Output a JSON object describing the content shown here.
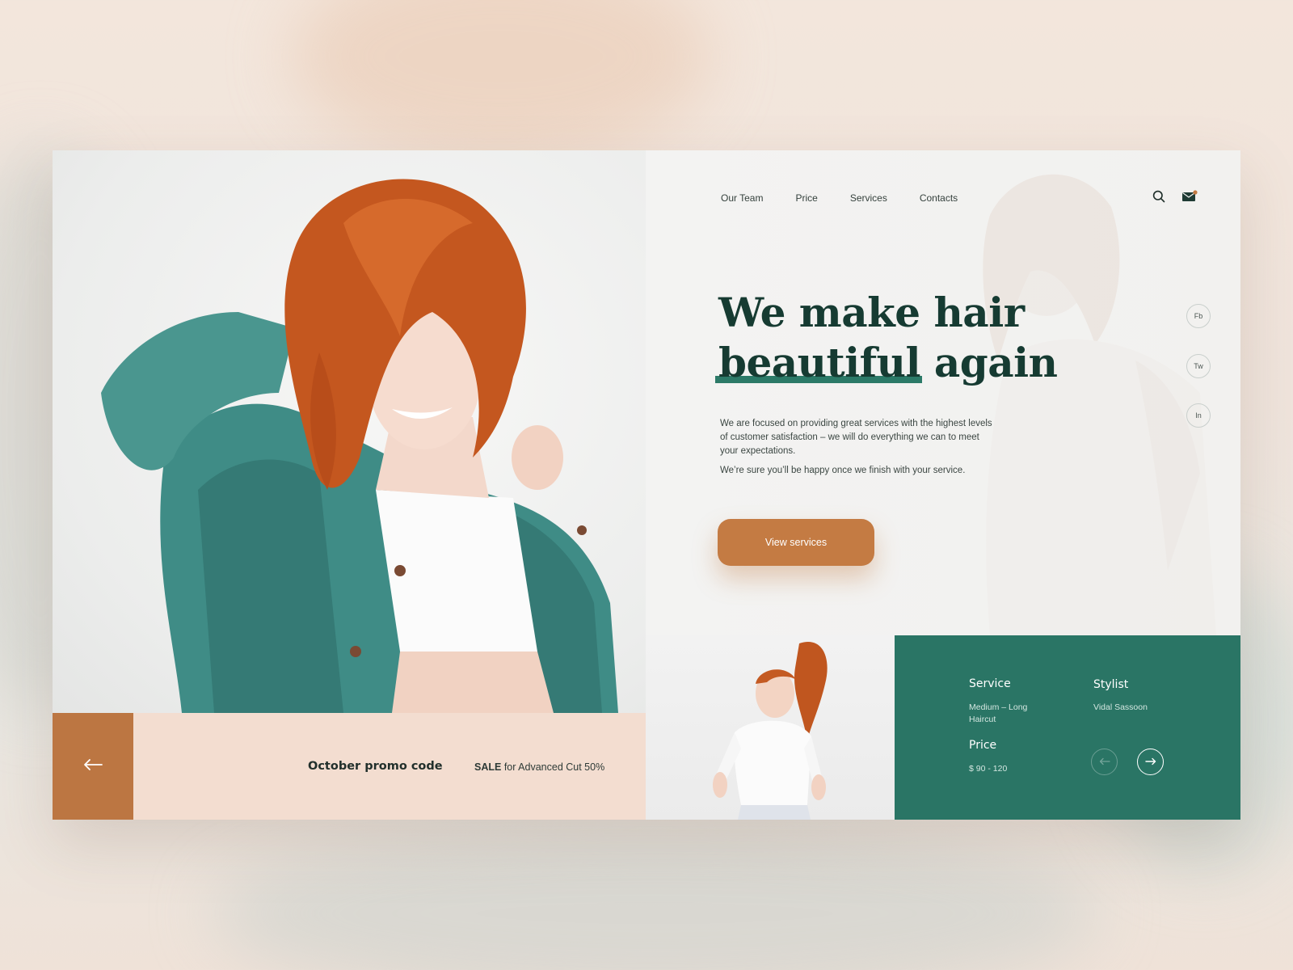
{
  "nav": {
    "items": [
      "Our Team",
      "Price",
      "Services",
      "Contacts"
    ]
  },
  "icons": {
    "search": "search-icon",
    "mail": "mail-icon",
    "arrow_left": "arrow-left-icon",
    "arrow_right": "arrow-right-icon"
  },
  "hero": {
    "headline_line1": "We make hair",
    "headline_word_underlined": "beautiful",
    "headline_line2_rest": " again",
    "paragraph1": "We are focused on providing great services with the highest levels of customer satisfaction – we will do everything we can to meet your expectations.",
    "paragraph2": "We’re sure you’ll be happy once we finish with your service.",
    "cta_label": "View services"
  },
  "social": {
    "fb": "Fb",
    "tw": "Tw",
    "in": "In"
  },
  "promo": {
    "title": "October promo code",
    "sale_strong": "SALE",
    "sale_rest": " for Advanced Cut 50%"
  },
  "service_card": {
    "service_label": "Service",
    "service_value": "Medium – Long Haircut",
    "stylist_label": "Stylist",
    "stylist_value": "Vidal Sassoon",
    "price_label": "Price",
    "price_value": "$ 90 - 120"
  },
  "colors": {
    "accent_orange": "#c47b43",
    "accent_green": "#2a7565",
    "headline": "#163b32",
    "promo_bg": "#f3ddd0"
  }
}
